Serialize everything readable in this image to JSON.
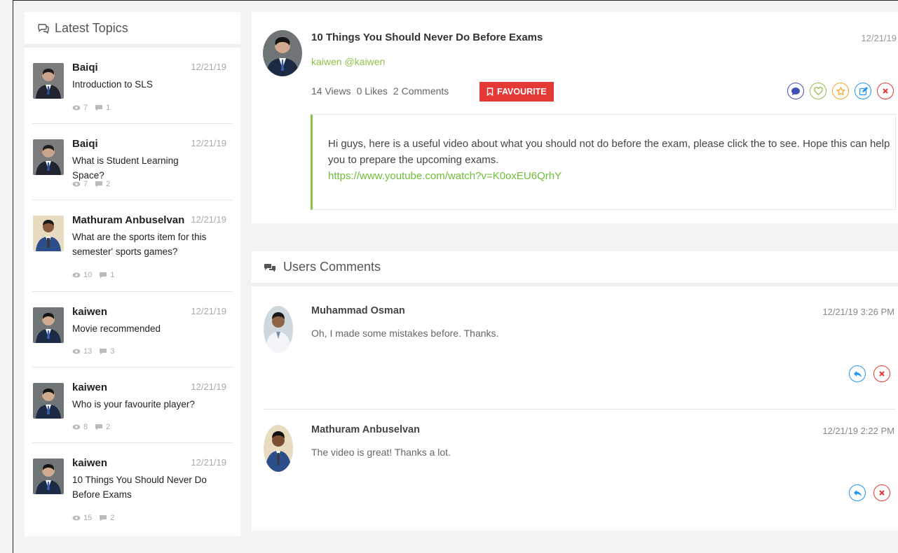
{
  "sidebar": {
    "title": "Latest Topics",
    "topics": [
      {
        "name": "Baiqi",
        "date": "12/21/19",
        "title": "Introduction to SLS",
        "views": "7",
        "comments": "1"
      },
      {
        "name": "Baiqi",
        "date": "12/21/19",
        "title": "What is Student Learning Space?",
        "views": "7",
        "comments": "2"
      },
      {
        "name": "Mathuram Anbuselvan",
        "date": "12/21/19",
        "title": "What are the sports item for this semester' sports games?",
        "views": "10",
        "comments": "1"
      },
      {
        "name": "kaiwen",
        "date": "12/21/19",
        "title": "Movie recommended",
        "views": "13",
        "comments": "3"
      },
      {
        "name": "kaiwen",
        "date": "12/21/19",
        "title": "Who is your favourite player?",
        "views": "8",
        "comments": "2"
      },
      {
        "name": "kaiwen",
        "date": "12/21/19",
        "title": "10 Things You Should Never Do Before Exams",
        "views": "15",
        "comments": "2"
      }
    ]
  },
  "post": {
    "title": "10 Things You Should Never Do Before Exams",
    "date": "12/21/19",
    "handle": "kaiwen @kaiwen",
    "views": "14 Views",
    "likes": "0 Likes",
    "comments": "2 Comments",
    "favourite_label": "FAVOURITE",
    "body_text": "Hi guys, here is a useful video about what you should not do before the exam, please click the to see. Hope this can help you to prepare the upcoming exams.",
    "link": "https://www.youtube.com/watch?v=K0oxEU6QrhY",
    "colors": {
      "accent_green": "#8bc34a",
      "favourite_red": "#e53935"
    }
  },
  "comments_section": {
    "title": "Users Comments",
    "items": [
      {
        "name": "Muhammad Osman",
        "date": "12/21/19 3:26 PM",
        "text": "Oh, I made some mistakes before. Thanks."
      },
      {
        "name": "Mathuram Anbuselvan",
        "date": "12/21/19 2:22 PM",
        "text": "The video is great! Thanks a lot."
      }
    ]
  },
  "icons": {
    "sidebar_header": "chat-bubbles-icon",
    "views": "eye-icon",
    "comments": "comment-icon",
    "favourite": "bookmark-icon",
    "post_actions": [
      "comment-icon",
      "heart-icon",
      "star-icon",
      "edit-icon",
      "close-icon"
    ],
    "comment_actions": [
      "reply-icon",
      "close-icon"
    ]
  }
}
